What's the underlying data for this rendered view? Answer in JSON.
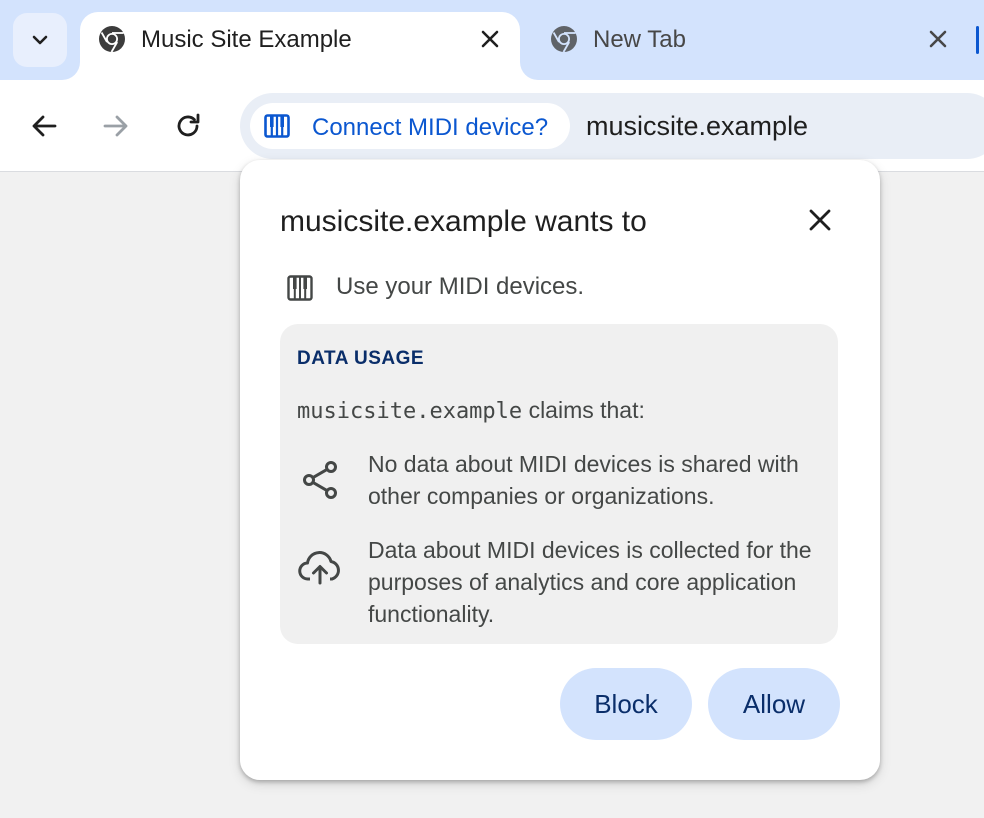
{
  "tabs": [
    {
      "title": "Music Site Example",
      "active": true,
      "favicon": "chrome-icon"
    },
    {
      "title": "New Tab",
      "active": false,
      "favicon": "chrome-icon"
    }
  ],
  "toolbar": {
    "back_icon": "arrow-back-icon",
    "forward_icon": "arrow-forward-icon",
    "reload_icon": "reload-icon"
  },
  "omnibox": {
    "chip_label": "Connect MIDI device?",
    "chip_icon": "midi-piano-icon",
    "url": "musicsite.example"
  },
  "bubble": {
    "title": "musicsite.example wants to",
    "permission_text": "Use your MIDI devices.",
    "data_usage": {
      "heading": "DATA USAGE",
      "claims_domain": "musicsite.example",
      "claims_suffix": "claims that:",
      "items": [
        {
          "icon": "share-icon",
          "text": "No data about MIDI devices is shared with other companies or organizations."
        },
        {
          "icon": "cloud-upload-icon",
          "text": "Data about MIDI devices is collected for the purposes of analytics and core application functionality."
        }
      ]
    },
    "buttons": {
      "block": "Block",
      "allow": "Allow"
    }
  },
  "colors": {
    "tabstrip": "#d3e3fd",
    "accent": "#0b57d0",
    "button_bg": "#d3e3fd",
    "button_text": "#0a2e6a"
  }
}
